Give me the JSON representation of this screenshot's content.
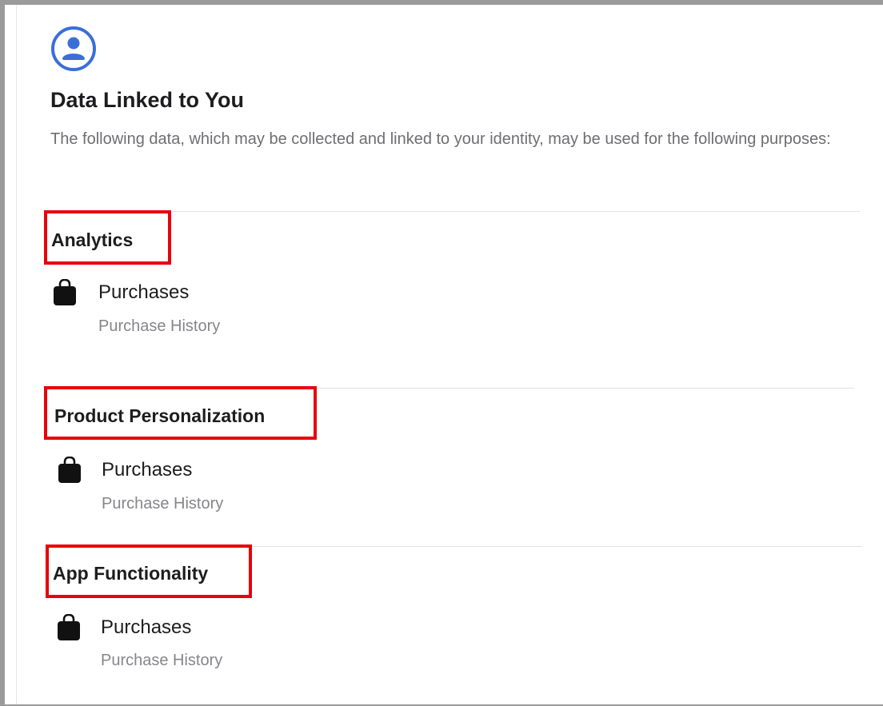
{
  "header": {
    "icon": "person-circle-icon",
    "title": "Data Linked to You",
    "description": "The following data, which may be collected and linked to your identity, may be used for the following purposes:"
  },
  "colors": {
    "accent": "#3a6fd8",
    "highlight_box": "#e8000b",
    "secondary_text": "#86868b"
  },
  "sections": [
    {
      "title": "Analytics",
      "items": [
        {
          "icon": "shopping-bag-icon",
          "label": "Purchases",
          "detail": "Purchase History"
        }
      ]
    },
    {
      "title": "Product Personalization",
      "items": [
        {
          "icon": "shopping-bag-icon",
          "label": "Purchases",
          "detail": "Purchase History"
        }
      ]
    },
    {
      "title": "App Functionality",
      "items": [
        {
          "icon": "shopping-bag-icon",
          "label": "Purchases",
          "detail": "Purchase History"
        }
      ]
    }
  ]
}
